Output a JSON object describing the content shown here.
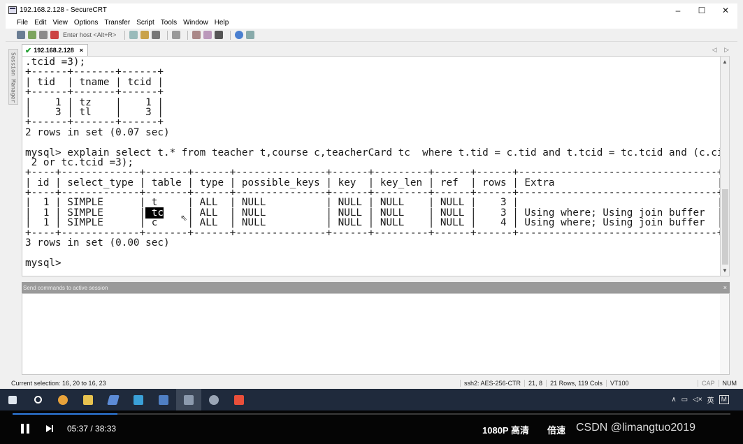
{
  "window": {
    "title": "192.168.2.128 - SecureCRT",
    "controls": [
      "–",
      "☐",
      "✕"
    ]
  },
  "menu": [
    "File",
    "Edit",
    "View",
    "Options",
    "Transfer",
    "Script",
    "Tools",
    "Window",
    "Help"
  ],
  "toolbar": {
    "host_placeholder": "Enter host <Alt+R>"
  },
  "tab": {
    "label": "192.168.2.128",
    "close": "×",
    "nav": "◁ ▷"
  },
  "session_manager": "Session Manager",
  "terminal": {
    "lines": [
      ".tcid =3);",
      "+------+-------+------+",
      "| tid  | tname | tcid |",
      "+------+-------+------+",
      "|    1 | tz    |    1 |",
      "|    3 | tl    |    3 |",
      "+------+-------+------+",
      "2 rows in set (0.07 sec)",
      "",
      "mysql> explain select t.* from teacher t,course c,teacherCard tc  where t.tid = c.tid and t.tcid = tc.tcid and (c.cid =",
      " 2 or tc.tcid =3);",
      "+----+-------------+-------+------+---------------+------+---------+------+------+---------------------------------+",
      "| id | select_type | table | type | possible_keys | key  | key_len | ref  | rows | Extra                           |",
      "+----+-------------+-------+------+---------------+------+---------+------+------+---------------------------------+",
      "|  1 | SIMPLE      | t     | ALL  | NULL          | NULL | NULL    | NULL |    3 |                                 |",
      "|  1 | SIMPLE      | tc    | ALL  | NULL          | NULL | NULL    | NULL |    3 | Using where; Using join buffer  |",
      "|  1 | SIMPLE      | c     | ALL  | NULL          | NULL | NULL    | NULL |    4 | Using where; Using join buffer  |",
      "+----+-------------+-------+------+---------------+------+---------+------+------+---------------------------------+",
      "3 rows in set (0.00 sec)",
      "",
      "mysql>"
    ],
    "selection_text": "tc"
  },
  "command_window": {
    "header": "Send commands to active session",
    "close": "×"
  },
  "status": {
    "selection": "Current selection: 16, 20 to 16, 23",
    "cipher": "ssh2: AES-256-CTR",
    "cursor": "21,  8",
    "size": "21 Rows, 119 Cols",
    "term": "VT100",
    "caps": "CAP",
    "num": "NUM"
  },
  "tray": {
    "lang": "英",
    "extra": "M"
  },
  "player": {
    "time": "05:37 / 38:33",
    "progress": 0.146,
    "quality": "1080P 高清",
    "speed": "倍速",
    "watermark": "CSDN @limangtuo2019"
  },
  "colors": {
    "accent_blue": "#2f7de1",
    "taskbar": "#1f2a3c",
    "check_green": "#1e9e2e"
  }
}
